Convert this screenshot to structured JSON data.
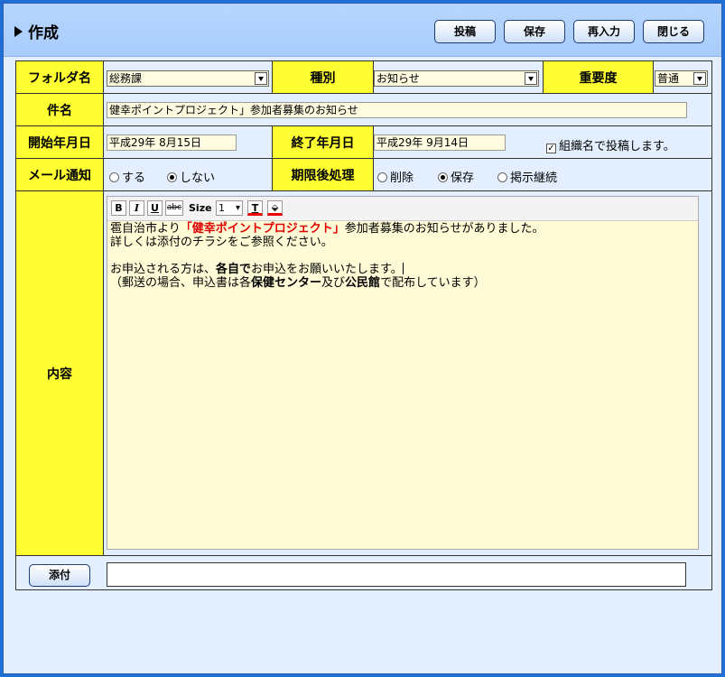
{
  "header": {
    "title": "作成",
    "buttons": {
      "post": "投稿",
      "save": "保存",
      "reenter": "再入力",
      "close": "閉じる"
    }
  },
  "form": {
    "folder": {
      "label": "フォルダ名",
      "value": "総務課"
    },
    "type": {
      "label": "種別",
      "value": "お知らせ"
    },
    "importance": {
      "label": "重要度",
      "value": "普通"
    },
    "subject": {
      "label": "件名",
      "value": "健幸ポイントプロジェクト」参加者募集のお知らせ"
    },
    "start_date": {
      "label": "開始年月日",
      "value": "平成29年 8月15日"
    },
    "end_date": {
      "label": "終了年月日",
      "value": "平成29年 9月14日"
    },
    "post_as_org": {
      "label": "組織名で投稿します。",
      "checked": true
    },
    "mail_notify": {
      "label": "メール通知",
      "options": [
        "する",
        "しない"
      ],
      "selected": "しない"
    },
    "after_expiry": {
      "label": "期限後処理",
      "options": [
        "削除",
        "保存",
        "掲示継続"
      ],
      "selected": "保存"
    },
    "content": {
      "label": "内容",
      "toolbar": {
        "bold": "B",
        "italic": "I",
        "underline": "U",
        "strike": "abc",
        "size_label": "Size",
        "size_value": "1",
        "text_color": "T"
      },
      "line1_pre": "雹自治市より",
      "line1_highlight": "「健幸ポイントプロジェクト」",
      "line1_post": "参加者募集のお知らせがありました。",
      "line2": "詳しくは添付のチラシをご参照ください。",
      "line3_pre": "お申込される方は、",
      "line3_bold": "各自で",
      "line3_post": "お申込をお願いいたします。",
      "line4_pre": "（郵送の場合、申込書は各",
      "line4_bold1": "保健センター",
      "line4_mid": "及び",
      "line4_bold2": "公民館",
      "line4_post": "で配布しています）"
    },
    "attach": {
      "button": "添付",
      "value": ""
    }
  }
}
